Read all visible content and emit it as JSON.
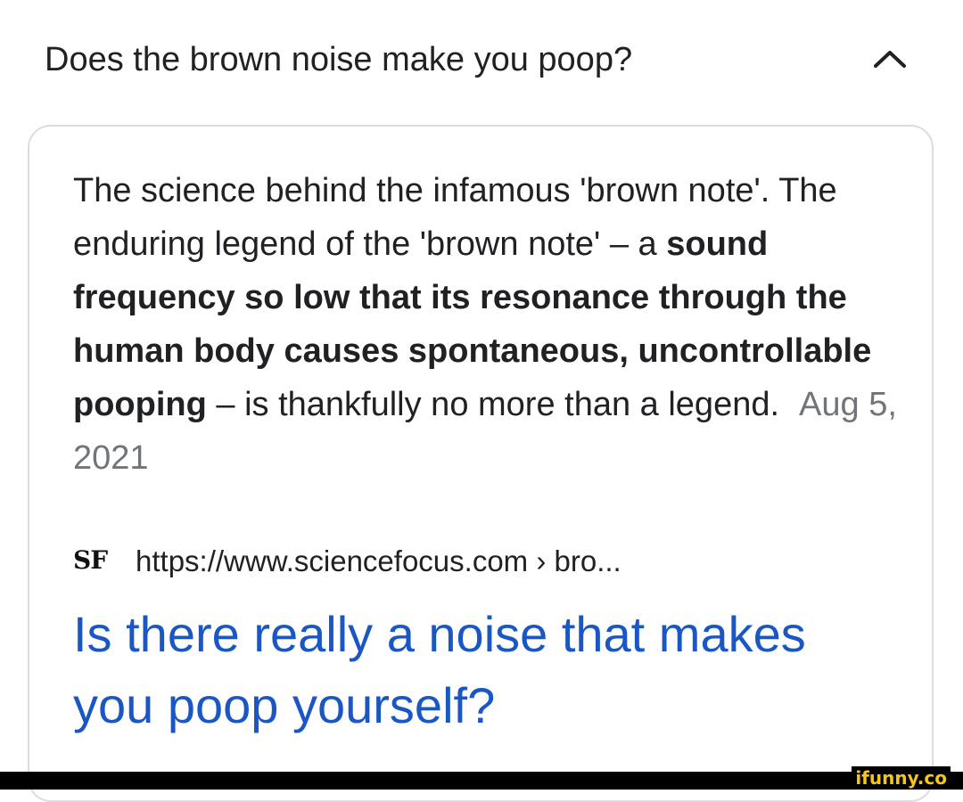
{
  "question": {
    "text": "Does the brown noise make you poop?",
    "toggle_icon": "chevron-up-icon"
  },
  "snippet": {
    "part1": "The science behind the infamous 'brown note'. The enduring legend of the 'brown note' – a ",
    "bold": "sound frequency so low that its resonance through the human body causes spontaneous, uncontrollable pooping",
    "part2": " – is thankfully no more than a legend.",
    "date": "Aug 5, 2021"
  },
  "source": {
    "favicon_text": "SF",
    "url": "https://www.sciencefocus.com › bro..."
  },
  "result": {
    "title": "Is there really a noise that makes you poop yourself?"
  },
  "watermark": {
    "text": "ifunny.co"
  },
  "colors": {
    "link": "#1a57c4",
    "date": "#70757a",
    "border": "#dadce0",
    "watermark": "#f5c518"
  }
}
